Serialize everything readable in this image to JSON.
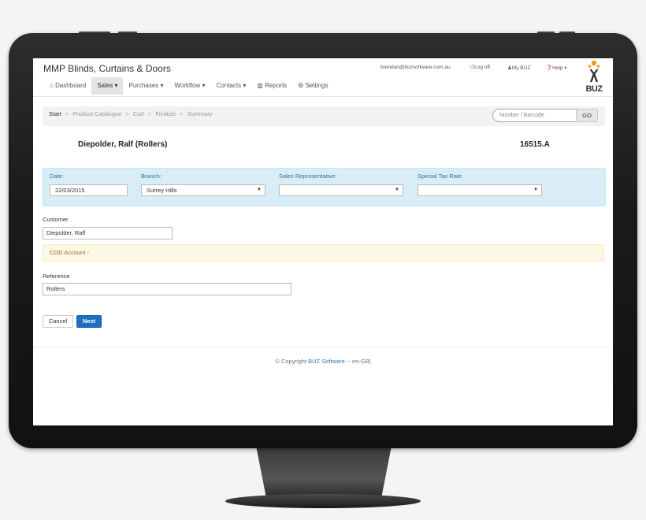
{
  "app": {
    "company_name": "MMP Blinds, Curtains & Doors",
    "logo_text": "BUZ"
  },
  "user_menu": {
    "email": "brendan@buzsoftware.com.au",
    "logoff": "Log off",
    "mybuz": "My BUZ",
    "help": "Help"
  },
  "nav": [
    {
      "label": "Dashboard",
      "icon": "home-icon",
      "dropdown": false,
      "active": false
    },
    {
      "label": "Sales",
      "icon": "",
      "dropdown": true,
      "active": true
    },
    {
      "label": "Purchases",
      "icon": "",
      "dropdown": true,
      "active": false
    },
    {
      "label": "Workflow",
      "icon": "",
      "dropdown": true,
      "active": false
    },
    {
      "label": "Contacts",
      "icon": "",
      "dropdown": true,
      "active": false
    },
    {
      "label": "Reports",
      "icon": "chart-icon",
      "dropdown": false,
      "active": false
    },
    {
      "label": "Settings",
      "icon": "gears-icon",
      "dropdown": false,
      "active": false
    }
  ],
  "breadcrumb": [
    "Start",
    "Product Catalogue",
    "Cart",
    "Finalize",
    "Summary"
  ],
  "scan": {
    "placeholder": "Number / Barcode",
    "go_label": "GO"
  },
  "order": {
    "title": "Diepolder, Ralf (Rollers)",
    "number": "16515.A"
  },
  "header_fields": {
    "date_label": "Date:",
    "date_value": "22/03/2015",
    "branch_label": "Branch:",
    "branch_value": "Surrey Hills",
    "sales_rep_label": "Sales Representative:",
    "sales_rep_value": "",
    "tax_label": "Special Tax Rate",
    "tax_value": ""
  },
  "customer": {
    "label": "Customer",
    "value": "Diepolder, Ralf",
    "account_note": "COD Account -"
  },
  "reference": {
    "label": "Reference",
    "value": "Rollers"
  },
  "actions": {
    "cancel": "Cancel",
    "next": "Next"
  },
  "footer": {
    "prefix": "© Copyright",
    "link": "BUZ Software",
    "suffix": "-- en-GB|"
  },
  "colors": {
    "primary": "#1e6fc4",
    "info_panel": "#d9edf7",
    "warning_panel": "#fcf8e3",
    "logo_orange": "#f39c12"
  }
}
